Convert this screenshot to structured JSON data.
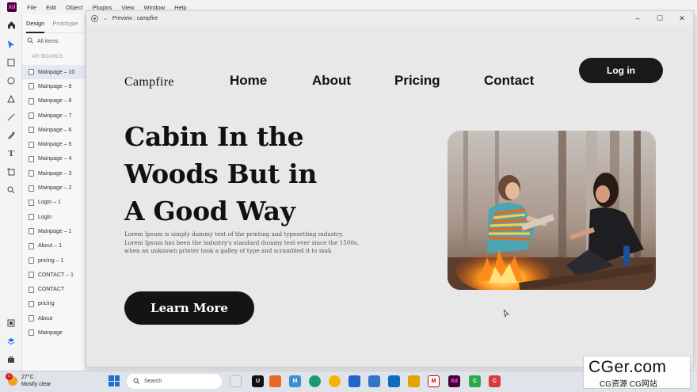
{
  "menubar": {
    "logo": "Xd",
    "items": [
      "File",
      "Edit",
      "Object",
      "Plugins",
      "View",
      "Window",
      "Help"
    ]
  },
  "toolbar": {
    "tools": [
      "select-arrow-icon",
      "rectangle-icon",
      "ellipse-icon",
      "triangle-icon",
      "line-icon",
      "pen-icon",
      "text-icon",
      "artboard-icon",
      "zoom-icon"
    ],
    "bottom": [
      "assets-icon",
      "layers-icon",
      "plugins-icon"
    ]
  },
  "layers": {
    "tabs": [
      "Design",
      "Prototype"
    ],
    "search_placeholder": "All items",
    "section": "ARTBOARDS",
    "items": [
      "Mainpage – 10",
      "Mainpage – 9",
      "Mainpage – 8",
      "Mainpage – 7",
      "Mainpage – 6",
      "Mainpage – 5",
      "Mainpage – 4",
      "Mainpage – 3",
      "Mainpage – 2",
      "Login – 1",
      "Login",
      "Mainpage – 1",
      "About – 1",
      "pricing – 1",
      "CONTACT – 1",
      "CONTACT",
      "pricing",
      "About",
      "Mainpage"
    ],
    "selected_index": 0
  },
  "preview": {
    "title": "Preview : campfire",
    "controls": {
      "minimize": "–",
      "maximize": "☐",
      "close": "✕"
    }
  },
  "site": {
    "brand": "Campfire",
    "nav": [
      "Home",
      "About",
      "Pricing",
      "Contact"
    ],
    "login": "Log in",
    "headline": [
      "Cabin In the",
      "Woods But in",
      "A Good Way"
    ],
    "body": [
      "Lorem Ipsum is simply dummy text of the printing and typesetting industry.",
      "Lorem Ipsum has been the industry's standard dummy text ever since the 1500s,",
      "when an unknown printer took a galley of type and scrambled it to mak"
    ],
    "cta": "Learn More"
  },
  "taskbar": {
    "weather_temp": "27°C",
    "weather_desc": "Mostly clear",
    "weather_badge": "1",
    "search": "Search"
  },
  "watermark": {
    "top": "CGer.com",
    "bottom": "CG资源 CG网站"
  },
  "colors": {
    "dark_button": "#141414",
    "xd_brand": "#470137",
    "selected_layer": "#e3e8f1"
  }
}
